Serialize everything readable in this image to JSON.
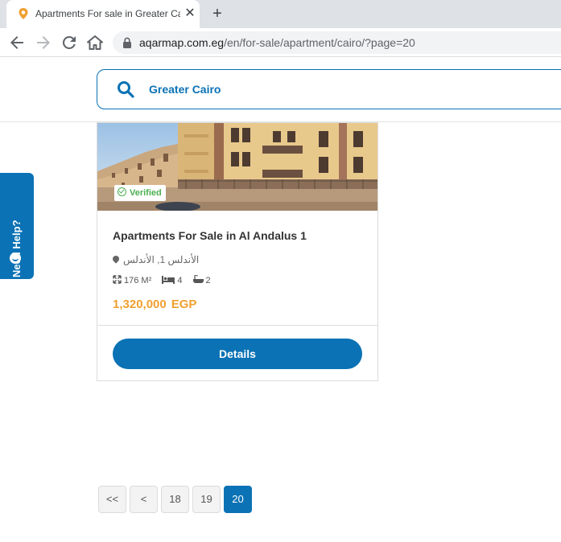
{
  "browser": {
    "tab_title": "Apartments For sale in Greater Ca",
    "tab_close": "✕",
    "new_tab": "+",
    "url_host": "aqarmap.com.eg",
    "url_path": "/en/for-sale/apartment/cairo/?page=20"
  },
  "header": {
    "search_value": "Greater Cairo"
  },
  "help": {
    "label": "Need Help?"
  },
  "listing": {
    "verified_label": "Verified",
    "title": "Apartments For Sale in Al Andalus 1",
    "location": "الأندلس 1, الأندلس",
    "area": "176 M²",
    "bedrooms": "4",
    "bathrooms": "2",
    "price": "1,320,000",
    "currency": "EGP",
    "details_label": "Details"
  },
  "pagination": {
    "first": "<<",
    "prev": "<",
    "pages": [
      "18",
      "19",
      "20"
    ],
    "current": "20"
  },
  "colors": {
    "brand_blue": "#0b72b5",
    "price_orange": "#f0a030",
    "verified_green": "#4caf50"
  }
}
